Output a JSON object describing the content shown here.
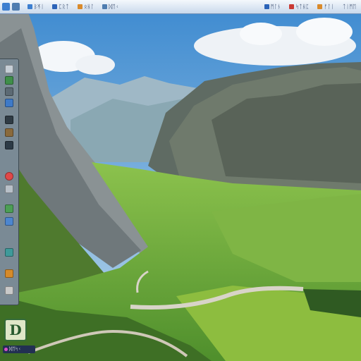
{
  "taskbar": {
    "items": [
      {
        "label": "ᛒᛡᛁ",
        "icon": "folder-icon",
        "color": "#3d7fd0"
      },
      {
        "label": "ᛈᚱᛏ",
        "icon": "blue-app-icon",
        "color": "#2b63b8"
      },
      {
        "label": "ᛟᚺᛚ",
        "icon": "orange-app-icon",
        "color": "#d98a2b"
      },
      {
        "label": "ᛞᛖᚲ",
        "icon": "document-icon",
        "color": "#4f7db0"
      }
    ],
    "right_items": [
      {
        "label": "ᛗᛚᚾ",
        "icon": "blue-app-icon",
        "color": "#2b63b8"
      },
      {
        "label": "ᛋᛏᚺᛈ",
        "icon": "red-app-icon",
        "color": "#c93a34"
      },
      {
        "label": "ᚠᛚᛁ",
        "icon": "orange-app-icon",
        "color": "#d98a2b"
      }
    ],
    "clock": "ᛏᛁᛗᛖ"
  },
  "dock": {
    "items": [
      {
        "icon": "app-icon",
        "color": "#c6ced6"
      },
      {
        "icon": "green-app-icon",
        "color": "#3f8f4a"
      },
      {
        "icon": "app-icon",
        "color": "#5c6a74"
      },
      {
        "icon": "blue-app-icon",
        "color": "#3e7ac8"
      },
      {
        "icon": "dark-app-icon",
        "color": "#2f3b44"
      },
      {
        "icon": "brown-app-icon",
        "color": "#8a6a3c"
      },
      {
        "icon": "dark-app-icon",
        "color": "#2c3a46"
      },
      {
        "icon": "record-icon",
        "color": "#e04848"
      },
      {
        "icon": "app-icon",
        "color": "#b8c0c8"
      },
      {
        "icon": "green-app-icon",
        "color": "#4c9f55"
      },
      {
        "icon": "blue-app-icon",
        "color": "#4d86cf"
      },
      {
        "icon": "teal-app-icon",
        "color": "#3f9a9a"
      },
      {
        "icon": "orange-app-icon",
        "color": "#d58a2a"
      },
      {
        "icon": "app-icon",
        "color": "#c9c9c9"
      }
    ]
  },
  "desktop": {
    "icon": "d-app-icon",
    "icon_letter": "D",
    "label": "ᛞᛖᛋᚲ",
    "label_bg": "#223052"
  },
  "colors": {
    "sky": "#5aa0d8",
    "meadow": "#6fae3a",
    "road": "#d8d4c8"
  }
}
